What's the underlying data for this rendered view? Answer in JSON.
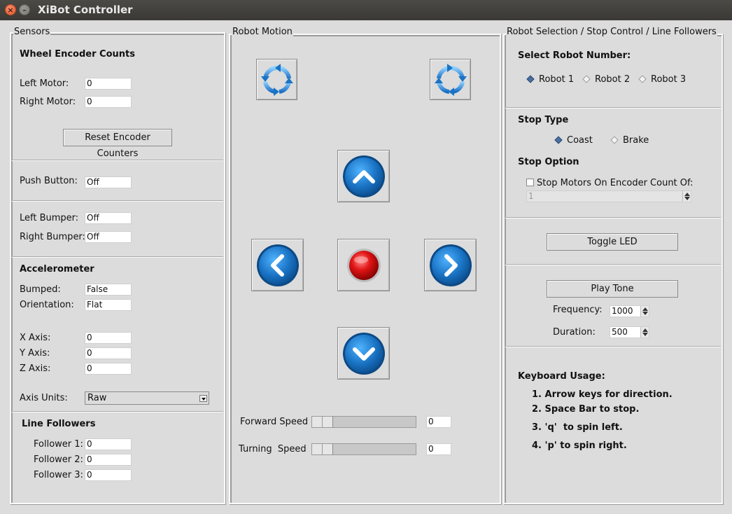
{
  "window": {
    "title": "XiBot Controller"
  },
  "sensors": {
    "group_title": "Sensors",
    "wheel_encoder_title": "Wheel Encoder Counts",
    "left_motor_label": "Left Motor:",
    "left_motor_value": "0",
    "right_motor_label": "Right Motor:",
    "right_motor_value": "0",
    "reset_button": "Reset Encoder Counters",
    "push_button_label": "Push Button:",
    "push_button_value": "Off",
    "left_bumper_label": "Left Bumper:",
    "left_bumper_value": "Off",
    "right_bumper_label": "Right Bumper:",
    "right_bumper_value": "Off",
    "accelerometer_title": "Accelerometer",
    "bumped_label": "Bumped:",
    "bumped_value": "False",
    "orientation_label": "Orientation:",
    "orientation_value": "Flat",
    "x_axis_label": "X Axis:",
    "x_axis_value": "0",
    "y_axis_label": "Y Axis:",
    "y_axis_value": "0",
    "z_axis_label": "Z Axis:",
    "z_axis_value": "0",
    "axis_units_label": "Axis Units:",
    "axis_units_value": "Raw",
    "line_followers_title": "Line Followers",
    "follower1_label": "Follower 1:",
    "follower1_value": "0",
    "follower2_label": "Follower 2:",
    "follower2_value": "0",
    "follower3_label": "Follower 3:",
    "follower3_value": "0"
  },
  "motion": {
    "group_title": "Robot Motion",
    "icons": {
      "spin_left": "rotate-counterclockwise-icon",
      "spin_right": "rotate-clockwise-icon",
      "forward": "chevron-up-icon",
      "left": "chevron-left-icon",
      "stop": "stop-icon",
      "right": "chevron-right-icon",
      "reverse": "chevron-down-icon"
    },
    "forward_speed_label": "Forward Speed",
    "forward_speed_value": "0",
    "turning_speed_label": "Turning  Speed",
    "turning_speed_value": "0"
  },
  "control": {
    "group_title": "Robot Selection / Stop Control / Line Followers",
    "select_title": "Select Robot Number:",
    "robots": [
      "Robot 1",
      "Robot 2",
      "Robot 3"
    ],
    "selected_robot": "Robot 1",
    "stop_type_title": "Stop Type",
    "stop_types": [
      "Coast",
      "Brake"
    ],
    "selected_stop_type": "Coast",
    "stop_option_title": "Stop Option",
    "stop_option_checkbox": "Stop Motors On Encoder Count Of:",
    "stop_option_checked": false,
    "encoder_count_value": "1",
    "toggle_led_button": "Toggle LED",
    "play_tone_button": "Play Tone",
    "frequency_label": "Frequency:",
    "frequency_value": "1000",
    "duration_label": "Duration:",
    "duration_value": "500",
    "keyboard_title": "Keyboard Usage:",
    "keyboard_items": [
      "1. Arrow keys for direction.",
      "2. Space Bar to stop.",
      "3. 'q'  to spin left.",
      "4. 'p' to spin right."
    ]
  },
  "colors": {
    "button_blue": "#1a6fb5",
    "stop_red": "#c81010",
    "window_bg": "#dcdcdc",
    "titlebar": "#3c3b37"
  }
}
